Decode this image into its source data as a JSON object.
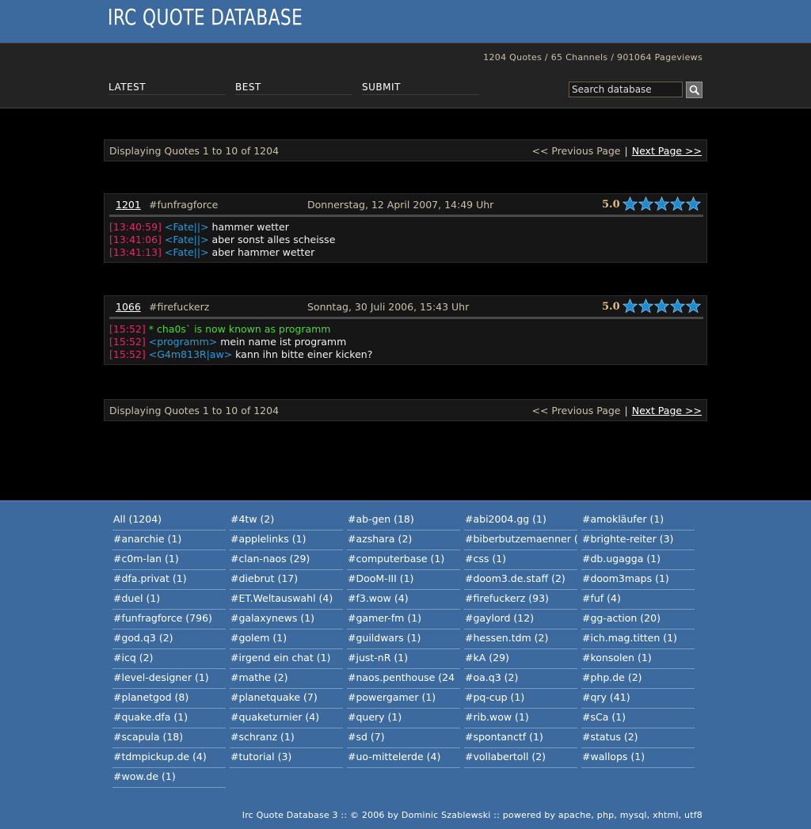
{
  "header": {
    "title": "IRC QUOTE DATABASE"
  },
  "stats": "1204 Quotes / 65 Channels / 901064 Pageviews",
  "nav": {
    "latest": "LATEST",
    "best": "BEST",
    "submit": "SUBMIT"
  },
  "search": {
    "placeholder": "Search database",
    "icon": "magnifier-icon"
  },
  "pager": {
    "displaying": "Displaying Quotes 1 to 10 of 1204",
    "previous": "<< Previous Page",
    "separator": "|",
    "next": "Next Page >>"
  },
  "quotes": [
    {
      "id": "1201",
      "channel": "#funfragforce",
      "date": "Donnerstag, 12 April 2007, 14:49 Uhr",
      "score": "5.0",
      "rating_stars": 5,
      "lines": [
        {
          "ts": "[13:40:59]",
          "nick": "<Fate||>",
          "text": "hammer wetter"
        },
        {
          "ts": "[13:41:06]",
          "nick": "<Fate||>",
          "text": "aber sonst alles scheisse"
        },
        {
          "ts": "[13:41:13]",
          "nick": "<Fate||>",
          "text": "aber hammer wetter"
        }
      ]
    },
    {
      "id": "1066",
      "channel": "#firefuckerz",
      "date": "Sonntag, 30 Juli 2006, 15:43 Uhr",
      "score": "5.0",
      "rating_stars": 5,
      "lines": [
        {
          "ts": "[15:52]",
          "action": "* cha0s` is now known as programm"
        },
        {
          "ts": "[15:52]",
          "nick": "<programm>",
          "text": "mein name ist programm"
        },
        {
          "ts": "[15:52]",
          "nick": "<G4m813R|aw>",
          "text": "kann ihn bitte einer kicken?"
        }
      ]
    }
  ],
  "channels": [
    "All (1204)",
    "#4tw (2)",
    "#ab-gen (18)",
    "#abi2004.gg (1)",
    "#amokläufer (1)",
    "#anarchie (1)",
    "#applelinks (1)",
    "#azshara (2)",
    "#biberbutzemaenner (",
    "#brighte-reiter (3)",
    "#c0m-lan (1)",
    "#clan-naos (29)",
    "#computerbase (1)",
    "#css (1)",
    "#db.ugagga (1)",
    "#dfa.privat (1)",
    "#diebrut (17)",
    "#DooM-III (1)",
    "#doom3.de.staff (2)",
    "#doom3maps (1)",
    "#duel (1)",
    "#ET.Weltauswahl (4)",
    "#f3.wow (4)",
    "#firefuckerz (93)",
    "#fuf (4)",
    "#funfragforce (796)",
    "#galaxynews (1)",
    "#gamer-fm (1)",
    "#gaylord (12)",
    "#gg-action (20)",
    "#god.q3 (2)",
    "#golem (1)",
    "#guildwars (1)",
    "#hessen.tdm (2)",
    "#ich.mag.titten (1)",
    "#icq (2)",
    "#irgend ein chat (1)",
    "#just-nR (1)",
    "#kA (29)",
    "#konsolen (1)",
    "#level-designer (1)",
    "#mathe (2)",
    "#naos.penthouse (24",
    "#oa.q3 (2)",
    "#php.de (2)",
    "#planetgod (8)",
    "#planetquake (7)",
    "#powergamer (1)",
    "#pq-cup (1)",
    "#qry (41)",
    "#quake.dfa (1)",
    "#quaketurnier (4)",
    "#query (1)",
    "#rib.wow (1)",
    "#sCa (1)",
    "#scapula (18)",
    "#schranz (1)",
    "#sd (7)",
    "#spontanctf (1)",
    "#status (2)",
    "#tdmpickup.de (4)",
    "#tutorial (3)",
    "#uo-mittelerde (4)",
    "#vollabertoll (2)",
    "#wallops (1)",
    "#wow.de (1)"
  ],
  "footer": "Irc Quote Database 3 :: © 2006 by Dominic Szablewski :: powered by apache, php, mysql, xhtml, utf8",
  "colors": {
    "header_blue": "#3c6a9e",
    "timestamp": "#e8246a",
    "nick": "#2a9ad8",
    "action": "#48d838",
    "star": "#1e8ad0"
  }
}
